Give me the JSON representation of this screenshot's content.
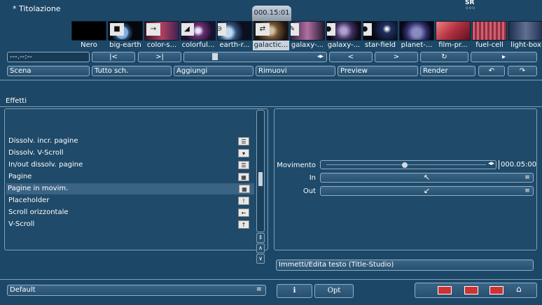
{
  "header": {
    "title": "* Titolazione",
    "sr_label": "SR",
    "sr_dots": "ooo",
    "timecode_bubble": "000.15:01"
  },
  "thumbnails": [
    {
      "label": "Nero"
    },
    {
      "label": "big-earth"
    },
    {
      "label": "color-s..."
    },
    {
      "label": "colorful..."
    },
    {
      "label": "earth-r..."
    },
    {
      "label": "galactic...",
      "selected": true
    },
    {
      "label": "galaxy-..."
    },
    {
      "label": "galaxy-..."
    },
    {
      "label": "star-field"
    },
    {
      "label": "planet-..."
    },
    {
      "label": "film-pr..."
    },
    {
      "label": "fuel-cell"
    },
    {
      "label": "light-box"
    }
  ],
  "transport": {
    "timecode": "---.--:--",
    "icons": [
      "skip-start-icon",
      "skip-end-icon",
      "stop-icon",
      "prev-icon",
      "next-icon",
      "loop-icon",
      "play-icon"
    ]
  },
  "toolbar": {
    "scena": "Scena",
    "tutto": "Tutto sch.",
    "aggiungi": "Aggiungi",
    "rimuovi": "Rimuovi",
    "preview": "Preview",
    "render": "Render"
  },
  "effects": {
    "section_label": "Effetti",
    "items": [
      {
        "label": "Dissolv. incr. pagine",
        "icon": "page-icon"
      },
      {
        "label": "Dissolv. V-Scroll",
        "icon": "vscroll-icon"
      },
      {
        "label": "In/out dissolv. pagine",
        "icon": "page-icon"
      },
      {
        "label": "Pagine",
        "icon": "pages-icon"
      },
      {
        "label": "Pagine in movim.",
        "icon": "pages-move-icon",
        "selected": true
      },
      {
        "label": "Placeholder",
        "icon": "placeholder-icon"
      },
      {
        "label": "Scroll orizzontale",
        "icon": "hscroll-icon"
      },
      {
        "label": "V-Scroll",
        "icon": "up-arrow-icon"
      }
    ]
  },
  "properties": {
    "movimento_label": "Movimento",
    "movimento_time": "000.05:00",
    "movimento_level": 0.48,
    "in_label": "In",
    "out_label": "Out"
  },
  "edit_text_button": "Immetti/Edita testo (Title-Studio)",
  "footer": {
    "default_select": "Default",
    "info_button": "i",
    "opt_button": "Opt"
  },
  "colors": {
    "background": "#1d4766",
    "selected": "#3b6384",
    "border": "#8fb0c8"
  }
}
